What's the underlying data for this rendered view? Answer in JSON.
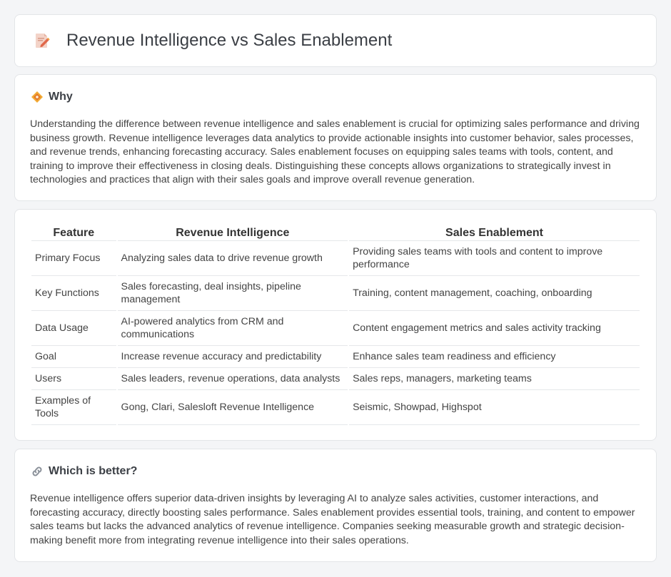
{
  "page": {
    "title": "Revenue Intelligence vs Sales Enablement",
    "icon": "document-pencil-icon"
  },
  "why": {
    "heading": "Why",
    "icon": "diamond-icon",
    "body": "Understanding the difference between revenue intelligence and sales enablement is crucial for optimizing sales performance and driving business growth. Revenue intelligence leverages data analytics to provide actionable insights into customer behavior, sales processes, and revenue trends, enhancing forecasting accuracy. Sales enablement focuses on equipping sales teams with tools, content, and training to improve their effectiveness in closing deals. Distinguishing these concepts allows organizations to strategically invest in technologies and practices that align with their sales goals and improve overall revenue generation."
  },
  "comparison": {
    "headers": [
      "Feature",
      "Revenue Intelligence",
      "Sales Enablement"
    ],
    "rows": [
      {
        "feature": "Primary Focus",
        "ri": "Analyzing sales data to drive revenue growth",
        "se": "Providing sales teams with tools and content to improve performance"
      },
      {
        "feature": "Key Functions",
        "ri": "Sales forecasting, deal insights, pipeline management",
        "se": "Training, content management, coaching, onboarding"
      },
      {
        "feature": "Data Usage",
        "ri": "AI-powered analytics from CRM and communications",
        "se": "Content engagement metrics and sales activity tracking"
      },
      {
        "feature": "Goal",
        "ri": "Increase revenue accuracy and predictability",
        "se": "Enhance sales team readiness and efficiency"
      },
      {
        "feature": "Users",
        "ri": "Sales leaders, revenue operations, data analysts",
        "se": "Sales reps, managers, marketing teams"
      },
      {
        "feature": "Examples of Tools",
        "ri": "Gong, Clari, Salesloft Revenue Intelligence",
        "se": "Seismic, Showpad, Highspot"
      }
    ]
  },
  "better": {
    "heading": "Which is better?",
    "icon": "link-icon",
    "body": "Revenue intelligence offers superior data-driven insights by leveraging AI to analyze sales activities, customer interactions, and forecasting accuracy, directly boosting sales performance. Sales enablement provides essential tools, training, and content to empower sales teams but lacks the advanced analytics of revenue intelligence. Companies seeking measurable growth and strategic decision-making benefit more from integrating revenue intelligence into their sales operations."
  }
}
